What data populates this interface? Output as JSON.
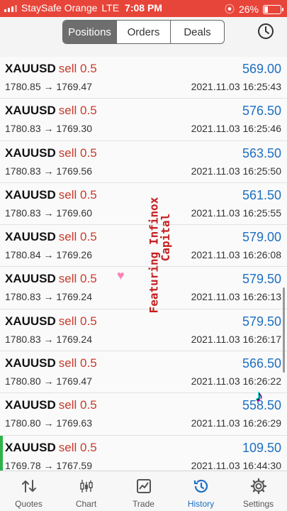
{
  "status": {
    "carrier": "StaySafe Orange",
    "network": "LTE",
    "time": "7:08 PM",
    "battery": "26%",
    "battery_level": 0.26
  },
  "header": {
    "tabs": [
      {
        "label": "Positions",
        "active": true
      },
      {
        "label": "Orders",
        "active": false
      },
      {
        "label": "Deals",
        "active": false
      }
    ]
  },
  "trades": [
    {
      "symbol": "XAUUSD",
      "side": "sell 0.5",
      "prices": "1780.85 → 1769.47",
      "profit": "569.00",
      "time": "2021.11.03 16:25:43"
    },
    {
      "symbol": "XAUUSD",
      "side": "sell 0.5",
      "prices": "1780.83 → 1769.30",
      "profit": "576.50",
      "time": "2021.11.03 16:25:46"
    },
    {
      "symbol": "XAUUSD",
      "side": "sell 0.5",
      "prices": "1780.83 → 1769.56",
      "profit": "563.50",
      "time": "2021.11.03 16:25:50"
    },
    {
      "symbol": "XAUUSD",
      "side": "sell 0.5",
      "prices": "1780.83 → 1769.60",
      "profit": "561.50",
      "time": "2021.11.03 16:25:55"
    },
    {
      "symbol": "XAUUSD",
      "side": "sell 0.5",
      "prices": "1780.84 → 1769.26",
      "profit": "579.00",
      "time": "2021.11.03 16:26:08"
    },
    {
      "symbol": "XAUUSD",
      "side": "sell 0.5",
      "prices": "1780.83 → 1769.24",
      "profit": "579.50",
      "time": "2021.11.03 16:26:13"
    },
    {
      "symbol": "XAUUSD",
      "side": "sell 0.5",
      "prices": "1780.83 → 1769.24",
      "profit": "579.50",
      "time": "2021.11.03 16:26:17"
    },
    {
      "symbol": "XAUUSD",
      "side": "sell 0.5",
      "prices": "1780.80 → 1769.47",
      "profit": "566.50",
      "time": "2021.11.03 16:26:22"
    },
    {
      "symbol": "XAUUSD",
      "side": "sell 0.5",
      "prices": "1780.80 → 1769.63",
      "profit": "558.50",
      "time": "2021.11.03 16:26:29"
    },
    {
      "symbol": "XAUUSD",
      "side": "sell 0.5",
      "prices": "1769.78 → 1767.59",
      "profit": "109.50",
      "time": "2021.11.03 16:44:30"
    }
  ],
  "overlay": {
    "line1": "Featuring Infinox",
    "line2": "Capital"
  },
  "tabbar": [
    {
      "label": "Quotes",
      "icon": "quotes-icon"
    },
    {
      "label": "Chart",
      "icon": "chart-icon"
    },
    {
      "label": "Trade",
      "icon": "trade-icon"
    },
    {
      "label": "History",
      "icon": "history-icon",
      "active": true
    },
    {
      "label": "Settings",
      "icon": "settings-icon"
    }
  ],
  "colors": {
    "status_bar": "#e8453a",
    "profit": "#1d6fc2",
    "sell": "#c83a2a",
    "active_tab": "#1d6fc2",
    "selected_marker": "#2db34a"
  }
}
